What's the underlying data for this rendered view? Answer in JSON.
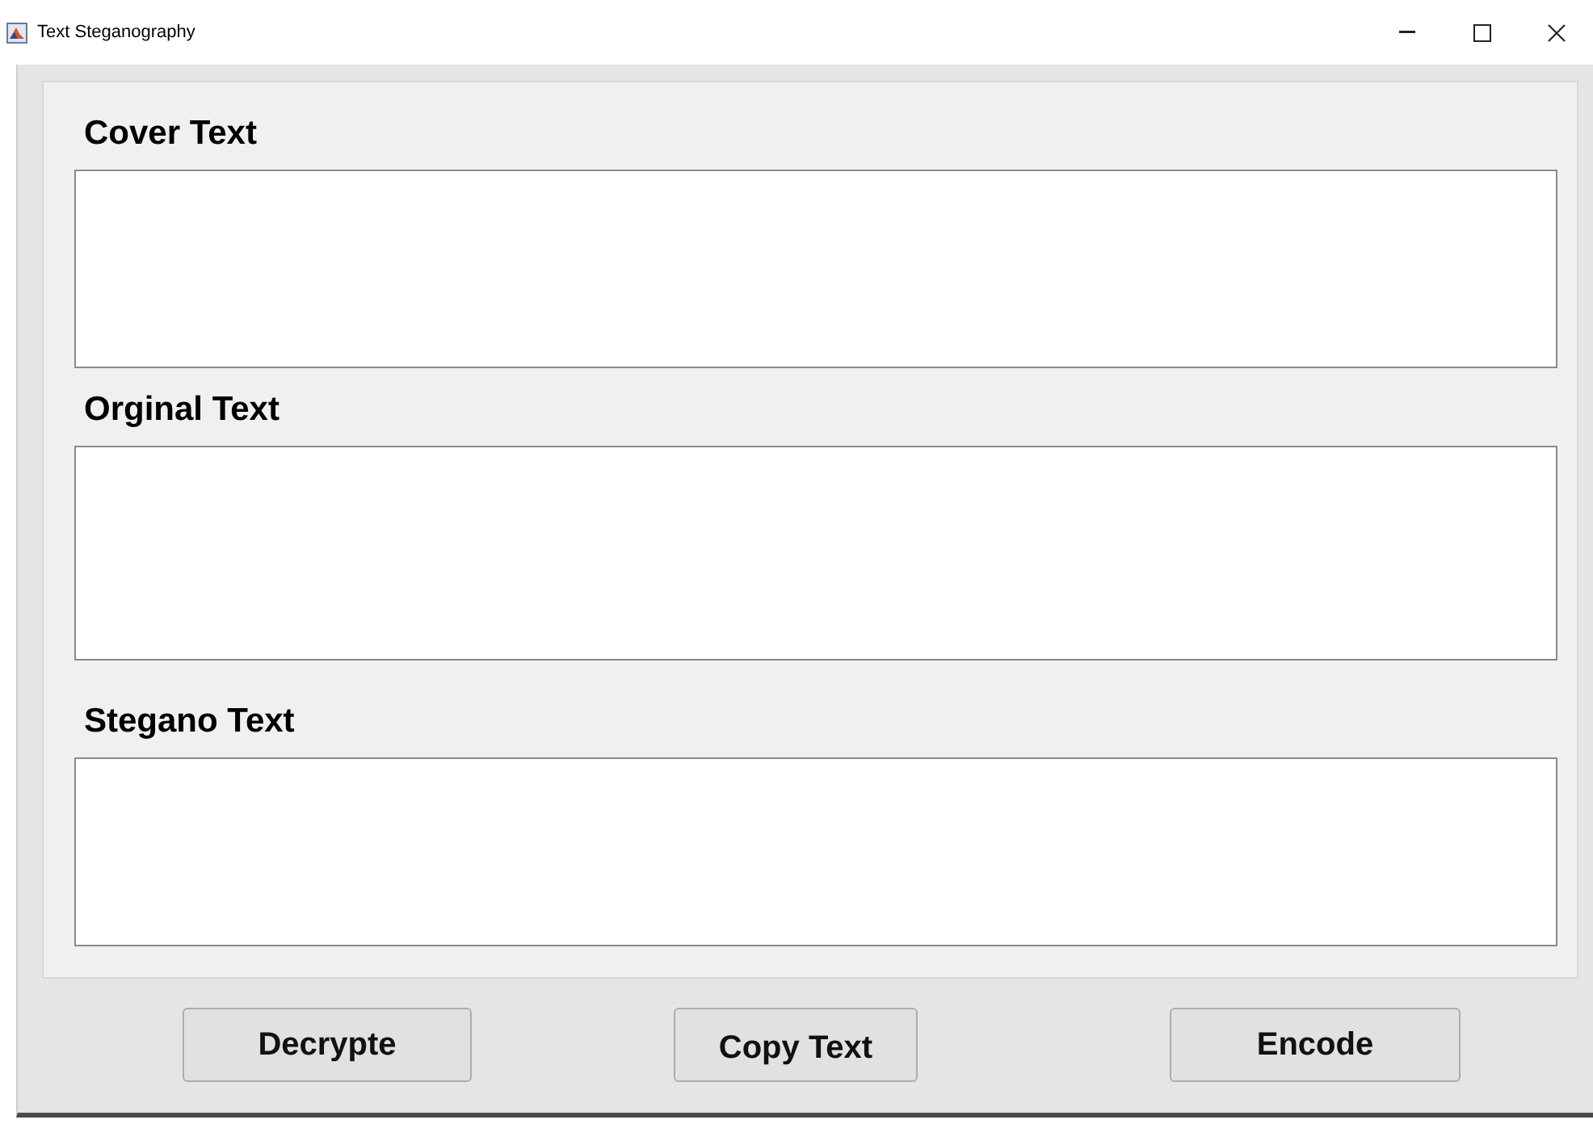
{
  "window": {
    "title": "Text Steganography"
  },
  "sections": [
    {
      "label": "Cover Text"
    },
    {
      "label": "Orginal Text"
    },
    {
      "label": "Stegano Text"
    }
  ],
  "buttons": [
    "Decrypte",
    "Copy Text",
    "Encode"
  ]
}
